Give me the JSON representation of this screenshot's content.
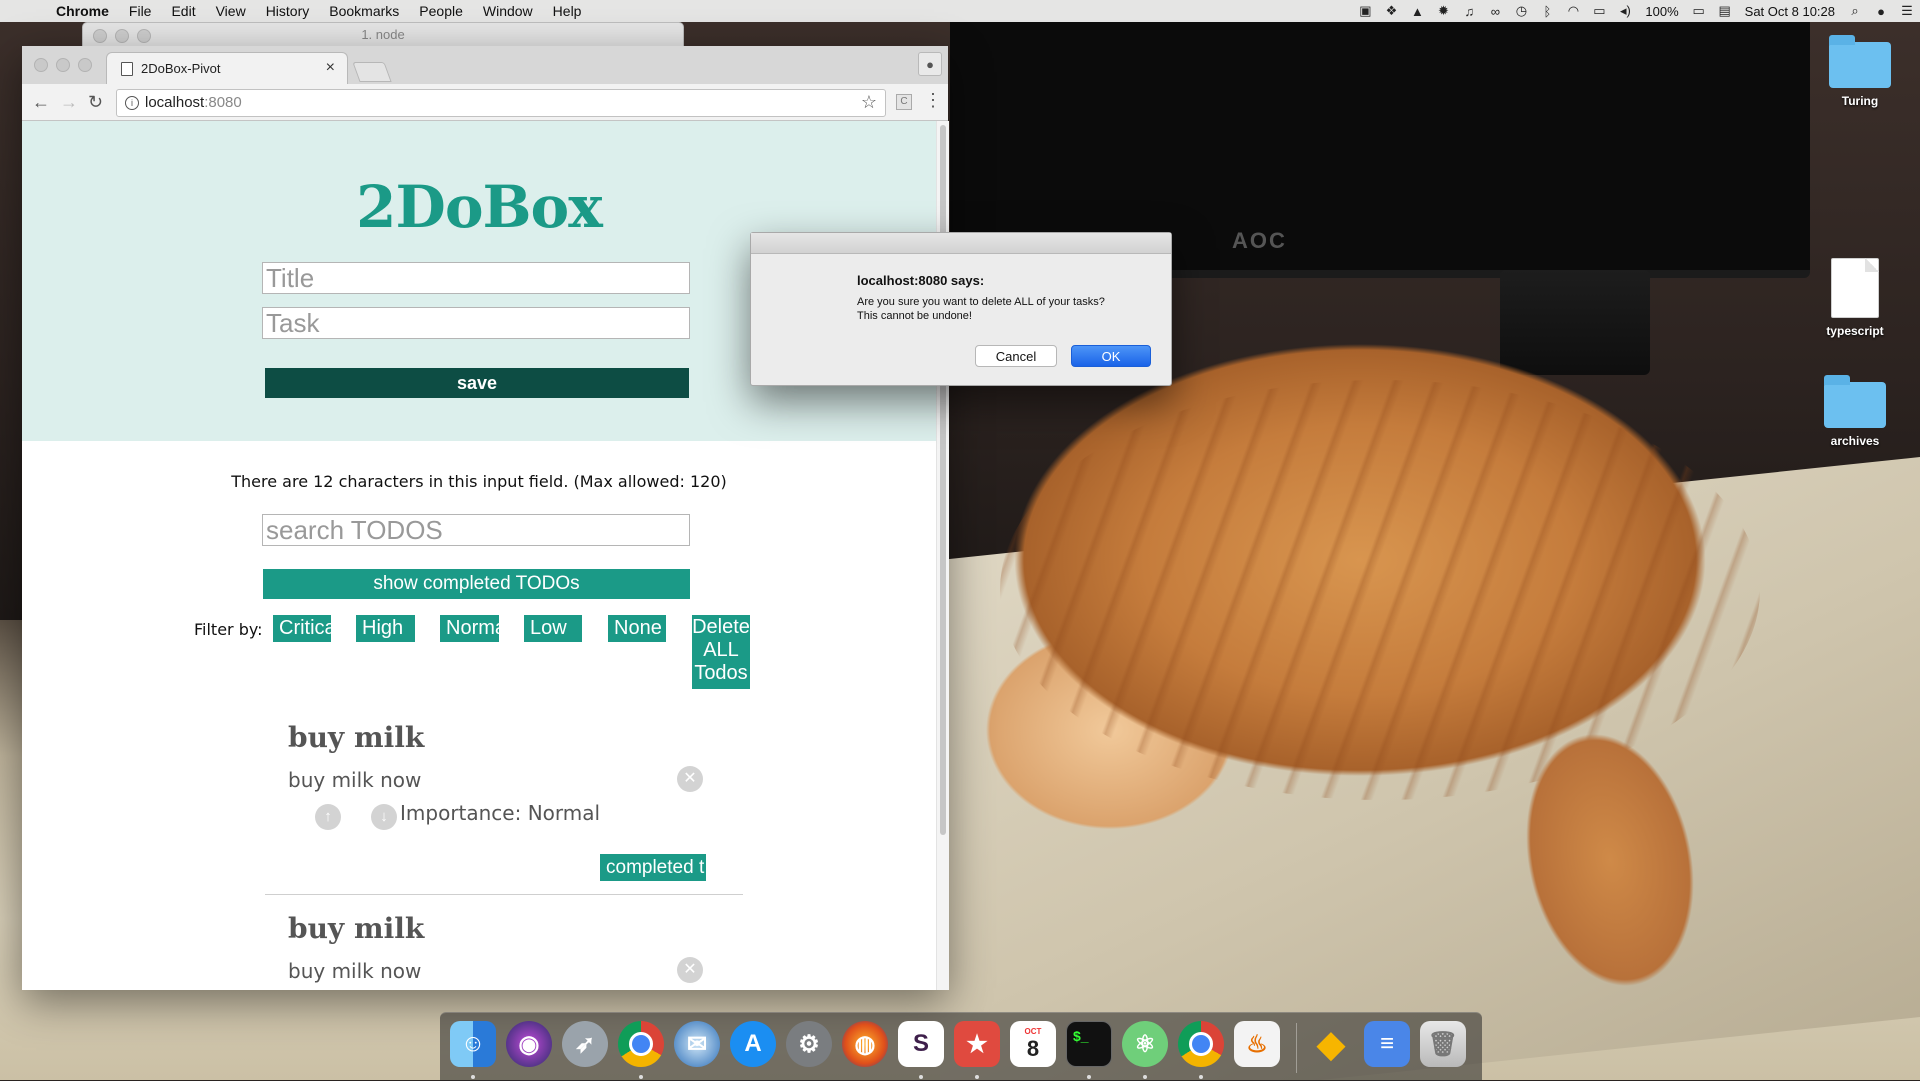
{
  "menubar": {
    "app_name": "Chrome",
    "menus": [
      "File",
      "Edit",
      "View",
      "History",
      "Bookmarks",
      "People",
      "Window",
      "Help"
    ],
    "status_icons": [
      "display-icon",
      "dropbox-icon",
      "drive-icon",
      "flux-icon",
      "headphones-icon",
      "loop-icon",
      "time-machine-icon",
      "bluetooth-icon",
      "wifi-icon",
      "airplay-icon",
      "volume-icon"
    ],
    "battery": "100%",
    "datetime": "Sat Oct 8  10:28"
  },
  "terminal": {
    "title": "1. node"
  },
  "browser": {
    "tab_title": "2DoBox-Pivot",
    "url_host": "localhost",
    "url_port": ":8080"
  },
  "app": {
    "logo": "2DoBox",
    "title_placeholder": "Title",
    "task_placeholder": "Task",
    "save_label": "save",
    "char_count_text": "There are 12 characters in this input field. (Max allowed: 120)",
    "search_placeholder": "search TODOS",
    "show_completed_label": "show completed TODOs",
    "filter_label": "Filter by:",
    "filters": [
      "Critica",
      "High",
      "Norma",
      "Low",
      "None"
    ],
    "delete_all_label": "Delete ALL Todos",
    "todos": [
      {
        "title": "buy milk",
        "body": "buy milk now",
        "importance": "Importance: Normal",
        "completed_label": "completed t"
      },
      {
        "title": "buy milk",
        "body": "buy milk now"
      }
    ],
    "accent_color": "#1b9a87",
    "dark_accent_color": "#0d4d44",
    "header_bg": "#dcefec"
  },
  "alert": {
    "title": "localhost:8080 says:",
    "message_line1": "Are you sure you want to delete ALL of your tasks?",
    "message_line2": "This cannot be undone!",
    "cancel_label": "Cancel",
    "ok_label": "OK"
  },
  "desktop_icons": [
    "Turing",
    "typescript",
    "archives"
  ],
  "dock": {
    "apps": [
      "Finder",
      "Siri",
      "Launchpad",
      "Chrome",
      "Thunderbird",
      "App Store",
      "System Preferences",
      "Firefox",
      "Slack",
      "Wunderlist",
      "Calendar",
      "Terminal",
      "Atom",
      "Chrome Canary",
      "Java",
      "Sketch",
      "Google Docs",
      "Trash"
    ],
    "calendar_month": "OCT",
    "calendar_day": "8"
  }
}
